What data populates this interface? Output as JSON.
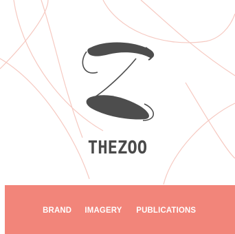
{
  "brand": {
    "name": "THEZOO",
    "logo_icon": "zoo-z-logo-icon",
    "text_color": "#4a4a4a"
  },
  "nav": {
    "items": [
      {
        "label": "BRAND"
      },
      {
        "label": "IMAGERY"
      },
      {
        "label": "PUBLICATIONS"
      }
    ],
    "band_color": "#f2857a",
    "text_color": "#ffffff"
  },
  "decoration": {
    "line_color": "#f6c9c1"
  }
}
